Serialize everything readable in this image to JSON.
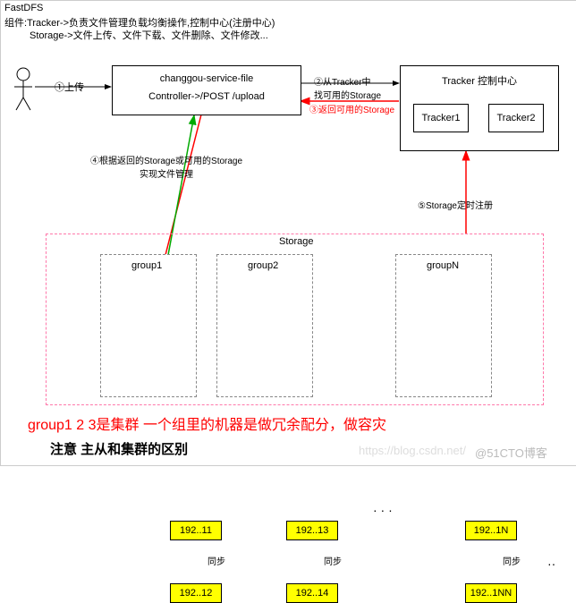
{
  "header": {
    "title": "FastDFS",
    "line1": "组件:Tracker->负责文件管理负载均衡操作,控制中心(注册中心)",
    "line2": "Storage->文件上传、文件下载、文件删除、文件修改..."
  },
  "actor": {
    "label": "①上传"
  },
  "service": {
    "name": "changgou-service-file",
    "controller": "Controller->/POST /upload"
  },
  "tracker": {
    "title": "Tracker  控制中心",
    "t1": "Tracker1",
    "t2": "Tracker2"
  },
  "arrows": {
    "a2": "②从Tracker中\n找可用的Storage",
    "a3": "③返回可用的Storage",
    "a4": "④根据返回的Storage或可用的Storage\n实现文件管理",
    "a5": "⑤Storage定时注册"
  },
  "storage": {
    "title": "Storage",
    "g1": {
      "name": "group1",
      "ip1": "192..11",
      "ip2": "192..12",
      "sync": "同步"
    },
    "g2": {
      "name": "group2",
      "ip1": "192..13",
      "ip2": "192..14",
      "sync": "同步"
    },
    "gN": {
      "name": "groupN",
      "ip1": "192..1N",
      "ip2": "192..1NN",
      "sync": "同步"
    },
    "dots": "·  ·  ·",
    "more": "··"
  },
  "footer": {
    "red": "group1 2 3是集群 一个组里的机器是做冗余配分，做容灾",
    "note": "注意  主从和集群的区别",
    "wm1": "https://blog.csdn.net/",
    "wm2": "@51CTO博客"
  }
}
